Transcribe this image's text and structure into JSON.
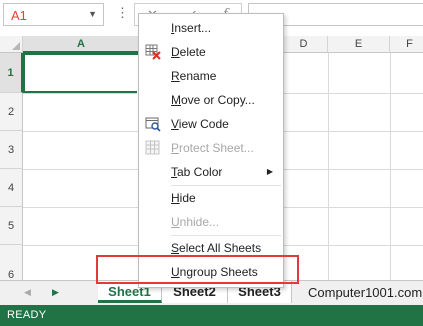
{
  "formula_bar": {
    "name_box": "A1",
    "cancel_icon": "✕",
    "enter_icon": "✓",
    "fx_label": "f"
  },
  "columns": [
    "A",
    "D",
    "E",
    "F"
  ],
  "rows": [
    "1",
    "2",
    "3",
    "4",
    "5",
    "6"
  ],
  "sheet_tabs": [
    "Sheet1",
    "Sheet2",
    "Sheet3"
  ],
  "active_sheet": "Sheet1",
  "watermark": "Computer1001.com",
  "status": "READY",
  "context_menu": {
    "items": [
      {
        "label": "Insert...",
        "icon": "",
        "enabled": true
      },
      {
        "label": "Delete",
        "icon": "delete-sheet-icon",
        "enabled": true
      },
      {
        "label": "Rename",
        "icon": "",
        "enabled": true
      },
      {
        "label": "Move or Copy...",
        "icon": "",
        "enabled": true
      },
      {
        "label": "View Code",
        "icon": "view-code-icon",
        "enabled": true
      },
      {
        "label": "Protect Sheet...",
        "icon": "protect-sheet-icon",
        "enabled": false
      },
      {
        "label": "Tab Color",
        "icon": "",
        "enabled": true,
        "submenu": true
      },
      {
        "label": "Hide",
        "icon": "",
        "enabled": true
      },
      {
        "label": "Unhide...",
        "icon": "",
        "enabled": false
      },
      {
        "label": "Select All Sheets",
        "icon": "",
        "enabled": true
      },
      {
        "label": "Ungroup Sheets",
        "icon": "",
        "enabled": true
      }
    ]
  },
  "colors": {
    "accent": "#217346",
    "highlight_box": "#e03a3a",
    "name_box_text": "#e0442f"
  }
}
